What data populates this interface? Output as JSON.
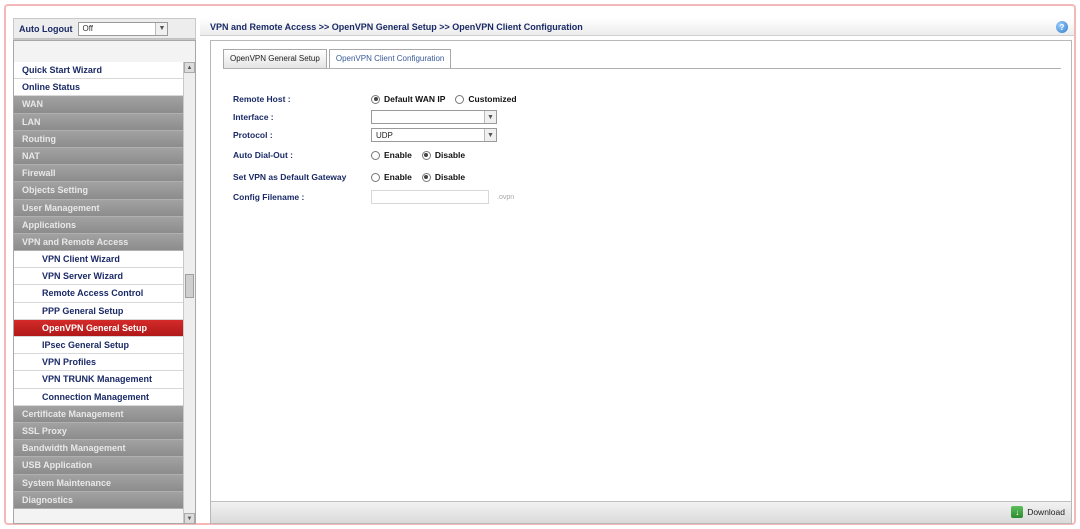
{
  "sidebar": {
    "autologout_label": "Auto Logout",
    "autologout_value": "Off",
    "items": [
      {
        "label": "Quick Start Wizard",
        "style": "white"
      },
      {
        "label": "Online Status",
        "style": "white"
      },
      {
        "label": "WAN",
        "style": "gray"
      },
      {
        "label": "LAN",
        "style": "gray"
      },
      {
        "label": "Routing",
        "style": "gray"
      },
      {
        "label": "NAT",
        "style": "gray"
      },
      {
        "label": "Firewall",
        "style": "gray"
      },
      {
        "label": "Objects Setting",
        "style": "gray"
      },
      {
        "label": "User Management",
        "style": "gray"
      },
      {
        "label": "Applications",
        "style": "gray"
      },
      {
        "label": "VPN and Remote Access",
        "style": "gray"
      },
      {
        "label": "VPN Client Wizard",
        "style": "sub"
      },
      {
        "label": "VPN Server Wizard",
        "style": "sub"
      },
      {
        "label": "Remote Access Control",
        "style": "sub"
      },
      {
        "label": "PPP General Setup",
        "style": "sub"
      },
      {
        "label": "OpenVPN General Setup",
        "style": "active"
      },
      {
        "label": "IPsec General Setup",
        "style": "sub"
      },
      {
        "label": "VPN Profiles",
        "style": "sub"
      },
      {
        "label": "VPN TRUNK Management",
        "style": "sub"
      },
      {
        "label": "Connection Management",
        "style": "sub"
      },
      {
        "label": "Certificate Management",
        "style": "gray"
      },
      {
        "label": "SSL Proxy",
        "style": "gray"
      },
      {
        "label": "Bandwidth Management",
        "style": "gray"
      },
      {
        "label": "USB Application",
        "style": "gray"
      },
      {
        "label": "System Maintenance",
        "style": "gray"
      },
      {
        "label": "Diagnostics",
        "style": "gray"
      }
    ]
  },
  "header": {
    "breadcrumb": "VPN and Remote Access >> OpenVPN General Setup >> OpenVPN Client Configuration"
  },
  "tabs": [
    {
      "label": "OpenVPN General Setup"
    },
    {
      "label": "OpenVPN Client Configuration"
    }
  ],
  "form": {
    "remote_host": {
      "label": "Remote Host :",
      "option1": "Default WAN IP",
      "option2": "Customized",
      "selected": "Default WAN IP"
    },
    "interface": {
      "label": "Interface :",
      "value": ""
    },
    "protocol": {
      "label": "Protocol :",
      "value": "UDP"
    },
    "auto_dial_out": {
      "label": "Auto Dial-Out :",
      "option1": "Enable",
      "option2": "Disable",
      "selected": "Disable"
    },
    "default_gateway": {
      "label": "Set VPN as Default Gateway",
      "option1": "Enable",
      "option2": "Disable",
      "selected": "Disable"
    },
    "config_filename": {
      "label": "Config Filename :",
      "value": "",
      "suffix": ".ovpn"
    }
  },
  "footer": {
    "download_label": "Download"
  },
  "colors": {
    "active_menu": "#c42020",
    "menu_gray": "#979797",
    "label_navy": "#1a2a66"
  }
}
